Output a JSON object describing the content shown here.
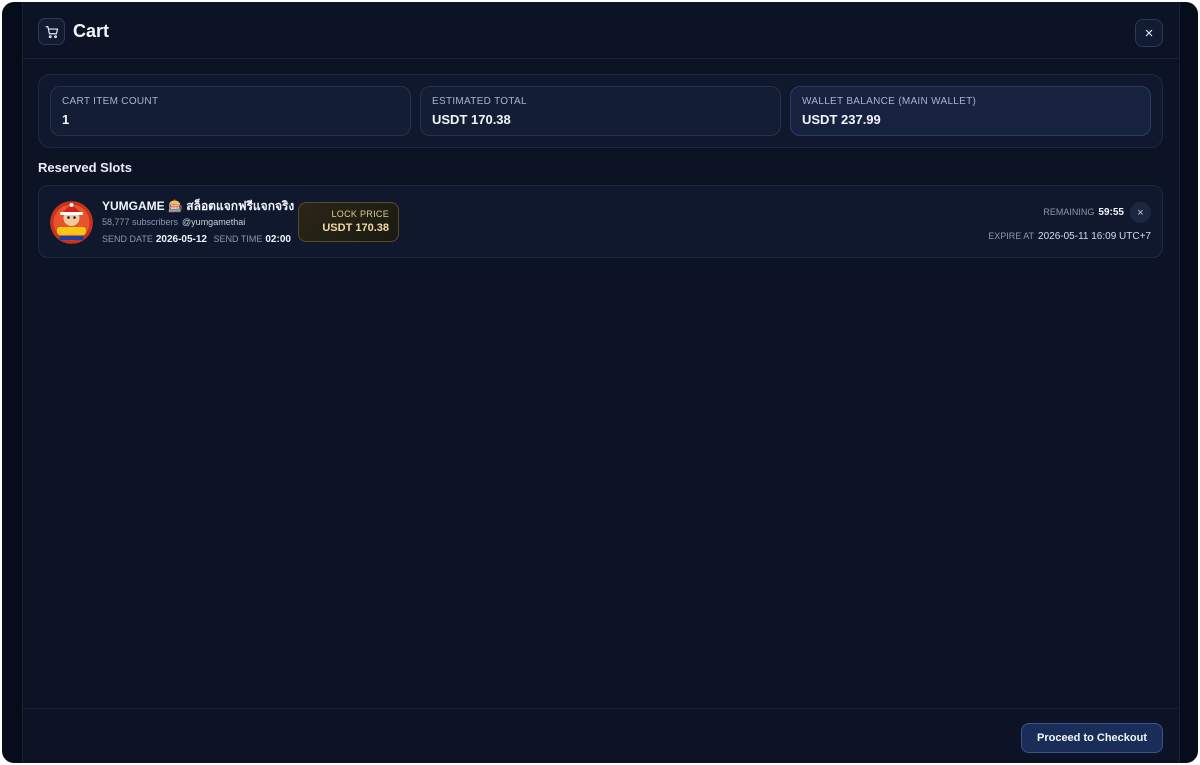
{
  "header": {
    "title": "Cart",
    "icon": "cart-icon",
    "close_icon": "close-icon",
    "close_label": "×"
  },
  "summary": {
    "cart_item_count": {
      "label": "CART ITEM COUNT",
      "value": "1"
    },
    "estimated_total": {
      "label": "ESTIMATED TOTAL",
      "value": "USDT 170.38"
    },
    "wallet_balance": {
      "label": "WALLET BALANCE (MAIN WALLET)",
      "value": "USDT 237.99"
    }
  },
  "reserved": {
    "title": "Reserved Slots",
    "items": [
      {
        "channel_name": "YUMGAME 🎰 สล็อตแจกฟรีแจกจริง",
        "subscribers": "58,777 subscribers",
        "handle": "@yumgamethai",
        "send_date_label": "SEND DATE",
        "send_date": "2026-05-12",
        "send_time_label": "SEND TIME",
        "send_time": "02:00",
        "lock_price_label": "LOCK PRICE",
        "lock_price": "USDT 170.38",
        "remaining_label": "REMAINING",
        "remaining": "59:55",
        "remove_label": "×",
        "expire_label": "EXPIRE AT",
        "expire_at": "2026-05-11 16:09 UTC+7",
        "avatar_icon": "channel-avatar"
      }
    ]
  },
  "footer": {
    "checkout_label": "Proceed to Checkout"
  },
  "colors": {
    "background": "#0b1325",
    "accent": "#1a2d58",
    "lock_border": "#5a4a2a"
  }
}
